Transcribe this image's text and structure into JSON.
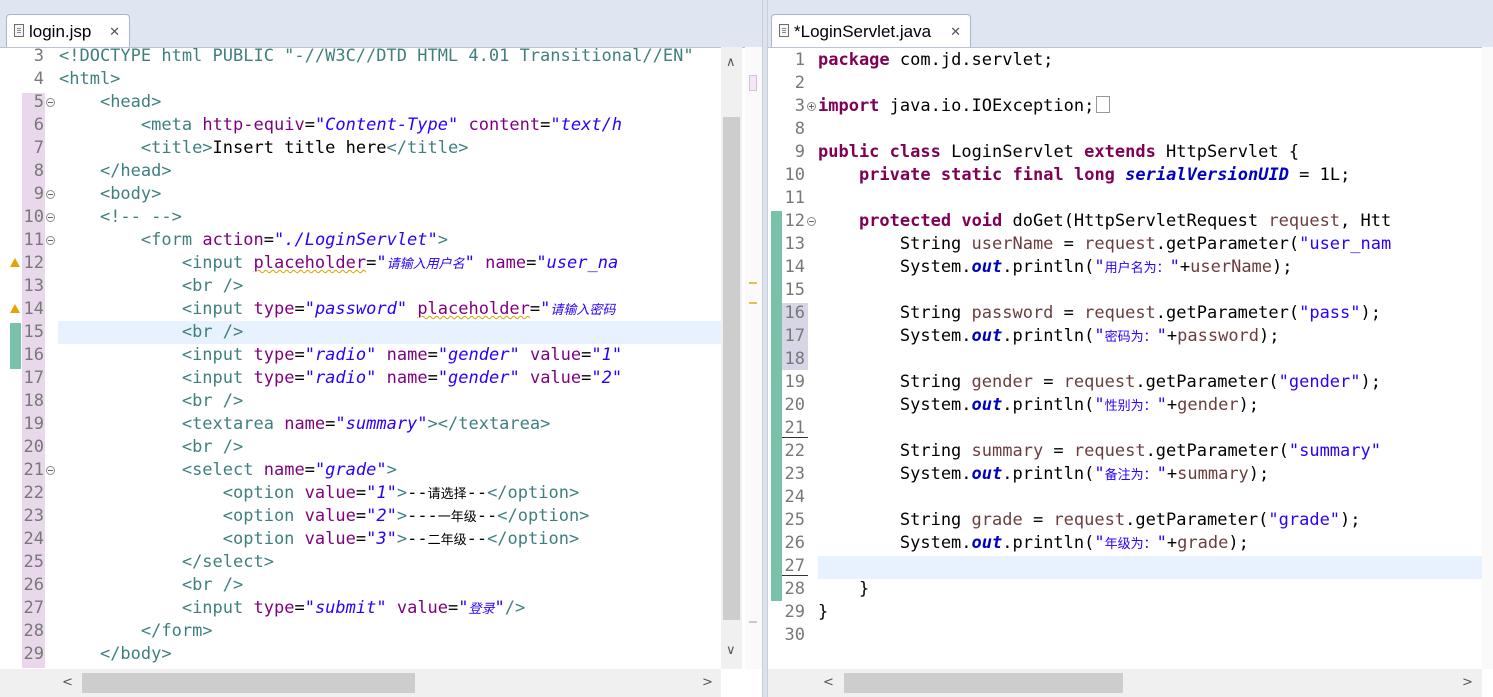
{
  "left_editor": {
    "tab": {
      "title": "login.jsp",
      "close": "✕"
    },
    "lines": [
      {
        "n": "3",
        "html": "<span class='t'>&lt;!DOCTYPE html PUBLIC \"-//W3C//DTD HTML 4.01 Transitional//EN\"</span>"
      },
      {
        "n": "4",
        "html": "<span class='t'>&lt;html&gt;</span>"
      },
      {
        "n": "5",
        "html": "    <span class='t'>&lt;head&gt;</span>"
      },
      {
        "n": "6",
        "html": "        <span class='t'>&lt;meta</span> <span class='a'>http-equiv</span>=<span class='v'>\"Content-Type\"</span> <span class='a'>content</span>=<span class='v'>\"text/h</span>"
      },
      {
        "n": "7",
        "html": "        <span class='t'>&lt;title&gt;</span>Insert title here<span class='t'>&lt;/title&gt;</span>"
      },
      {
        "n": "8",
        "html": "    <span class='t'>&lt;/head&gt;</span>"
      },
      {
        "n": "9",
        "html": "    <span class='t'>&lt;body&gt;</span>"
      },
      {
        "n": "10",
        "html": "    <span class='t'>&lt;!-- --&gt;</span>"
      },
      {
        "n": "11",
        "html": "        <span class='t'>&lt;form</span> <span class='a'>action</span>=<span class='v'>\"./LoginServlet\"</span><span class='t'>&gt;</span>"
      },
      {
        "n": "12",
        "html": "            <span class='t'>&lt;input</span> <span class='a squig'>placeholder</span>=<span class='v'>\"<span class='cjk'>请输入用户名</span>\"</span> <span class='a'>name</span>=<span class='v'>\"user_na</span>"
      },
      {
        "n": "13",
        "html": "            <span class='t'>&lt;br /&gt;</span>"
      },
      {
        "n": "14",
        "html": "            <span class='t'>&lt;input</span> <span class='a'>type</span>=<span class='v'>\"password\"</span> <span class='a squig'>placeholder</span>=<span class='v'>\"<span class='cjk'>请输入密码</span></span>"
      },
      {
        "n": "15",
        "html": "            <span class='t'>&lt;br /&gt;</span>"
      },
      {
        "n": "16",
        "html": "            <span class='t'>&lt;input</span> <span class='a'>type</span>=<span class='v'>\"radio\"</span> <span class='a'>name</span>=<span class='v'>\"gender\"</span> <span class='a'>value</span>=<span class='v'>\"1\"</span>"
      },
      {
        "n": "17",
        "html": "            <span class='t'>&lt;input</span> <span class='a'>type</span>=<span class='v'>\"radio\"</span> <span class='a'>name</span>=<span class='v'>\"gender\"</span> <span class='a'>value</span>=<span class='v'>\"2\"</span>"
      },
      {
        "n": "18",
        "html": "            <span class='t'>&lt;br /&gt;</span>"
      },
      {
        "n": "19",
        "html": "            <span class='t'>&lt;textarea</span> <span class='a'>name</span>=<span class='v'>\"summary\"</span><span class='t'>&gt;&lt;/textarea&gt;</span>"
      },
      {
        "n": "20",
        "html": "            <span class='t'>&lt;br /&gt;</span>"
      },
      {
        "n": "21",
        "html": "            <span class='t'>&lt;select</span> <span class='a'>name</span>=<span class='v'>\"grade\"</span><span class='t'>&gt;</span>"
      },
      {
        "n": "22",
        "html": "                <span class='t'>&lt;option</span> <span class='a'>value</span>=<span class='v'>\"1\"</span><span class='t'>&gt;</span>--<span class='cjk'>请选择</span>--<span class='t'>&lt;/option&gt;</span>"
      },
      {
        "n": "23",
        "html": "                <span class='t'>&lt;option</span> <span class='a'>value</span>=<span class='v'>\"2\"</span><span class='t'>&gt;</span>---<span class='cjk'>一年级</span>--<span class='t'>&lt;/option&gt;</span>"
      },
      {
        "n": "24",
        "html": "                <span class='t'>&lt;option</span> <span class='a'>value</span>=<span class='v'>\"3\"</span><span class='t'>&gt;</span>--<span class='cjk'>二年级</span>--<span class='t'>&lt;/option&gt;</span>"
      },
      {
        "n": "25",
        "html": "            <span class='t'>&lt;/select&gt;</span>"
      },
      {
        "n": "26",
        "html": "            <span class='t'>&lt;br /&gt;</span>"
      },
      {
        "n": "27",
        "html": "            <span class='t'>&lt;input</span> <span class='a'>type</span>=<span class='v'>\"submit\"</span> <span class='a'>value</span>=<span class='v'>\"<span class='cjk'>登录</span>\"</span><span class='t'>/&gt;</span>"
      },
      {
        "n": "28",
        "html": "        <span class='t'>&lt;/form&gt;</span>"
      },
      {
        "n": "29",
        "html": "    <span class='t'>&lt;/body&gt;</span>"
      }
    ]
  },
  "right_editor": {
    "tab": {
      "title": "*LoginServlet.java",
      "close": "✕"
    },
    "lines": [
      {
        "n": "1",
        "html": "<span class='k'>package</span> com.jd.servlet;"
      },
      {
        "n": "2",
        "html": ""
      },
      {
        "n": "3",
        "html": "<span class='k'>import</span> java.io.IOException;<span style='display:inline-block;width:12px;height:15px;border:1px solid #999;vertical-align:-2px;margin-left:2px;'></span>"
      },
      {
        "n": "8",
        "html": ""
      },
      {
        "n": "9",
        "html": "<span class='k'>public</span> <span class='k'>class</span> LoginServlet <span class='k'>extends</span> HttpServlet {"
      },
      {
        "n": "10",
        "html": "    <span class='k'>private</span> <span class='k'>static</span> <span class='k'>final</span> <span class='k'>long</span> <span class='f'>serialVersionUID</span> = 1L;"
      },
      {
        "n": "11",
        "html": ""
      },
      {
        "n": "12",
        "html": "    <span class='k'>protected</span> <span class='k'>void</span> doGet(HttpServletRequest <span class='vn'>request</span>, Htt"
      },
      {
        "n": "13",
        "html": "        String <span class='vn'>userName</span> = <span class='vn'>request</span>.getParameter(<span class='s'>\"user_nam</span>"
      },
      {
        "n": "14",
        "html": "        System.<span class='o'>out</span>.println(<span class='s'>\"<span class='cjk'>用户名为：</span>\"</span>+<span class='vn'>userName</span>);"
      },
      {
        "n": "15",
        "html": ""
      },
      {
        "n": "16",
        "html": "        String <span class='vn'>password</span> = <span class='vn'>request</span>.getParameter(<span class='s'>\"pass\"</span>);"
      },
      {
        "n": "17",
        "html": "        System.<span class='o'>out</span>.println(<span class='s'>\"<span class='cjk'>密码为：</span>\"</span>+<span class='vn'>password</span>);"
      },
      {
        "n": "18",
        "html": ""
      },
      {
        "n": "19",
        "html": "        String <span class='vn'>gender</span> = <span class='vn'>request</span>.getParameter(<span class='s'>\"gender\"</span>);"
      },
      {
        "n": "20",
        "html": "        System.<span class='o'>out</span>.println(<span class='s'>\"<span class='cjk'>性别为：</span>\"</span>+<span class='vn'>gender</span>);"
      },
      {
        "n": "21",
        "html": ""
      },
      {
        "n": "22",
        "html": "        String <span class='vn'>summary</span> = <span class='vn'>request</span>.getParameter(<span class='s'>\"summary\"</span>"
      },
      {
        "n": "23",
        "html": "        System.<span class='o'>out</span>.println(<span class='s'>\"<span class='cjk'>备注为：</span>\"</span>+<span class='vn'>summary</span>);"
      },
      {
        "n": "24",
        "html": ""
      },
      {
        "n": "25",
        "html": "        String <span class='vn'>grade</span> = <span class='vn'>request</span>.getParameter(<span class='s'>\"grade\"</span>);"
      },
      {
        "n": "26",
        "html": "        System.<span class='o'>out</span>.println(<span class='s'>\"<span class='cjk'>年级为：</span>\"</span>+<span class='vn'>grade</span>);"
      },
      {
        "n": "27",
        "html": ""
      },
      {
        "n": "28",
        "html": "    }"
      },
      {
        "n": "29",
        "html": "}"
      },
      {
        "n": "30",
        "html": ""
      }
    ]
  },
  "scroll": {
    "up": "∧",
    "down": "∨",
    "left": "<",
    "right": ">"
  },
  "colors": {
    "keyword": "#7f0055",
    "tag": "#3f7f7f",
    "attribute": "#7f007f",
    "string": "#2a00ff",
    "current_line": "#e8f2fe"
  }
}
